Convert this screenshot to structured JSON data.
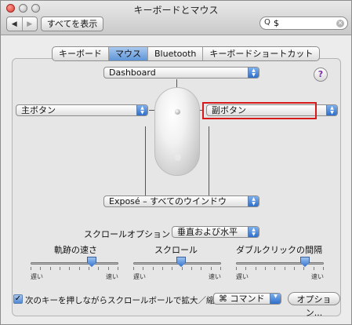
{
  "window": {
    "title": "キーボードとマウス"
  },
  "toolbar": {
    "back_glyph": "◀",
    "forward_glyph": "▶",
    "show_all": "すべてを表示"
  },
  "search": {
    "value": "$",
    "icon": "search-icon"
  },
  "tabs": [
    {
      "label": "キーボード",
      "selected": false
    },
    {
      "label": "マウス",
      "selected": true
    },
    {
      "label": "Bluetooth",
      "selected": false
    },
    {
      "label": "キーボードショートカット",
      "selected": false
    }
  ],
  "mouse_buttons": {
    "top": "Dashboard",
    "left": "主ボタン",
    "right": "副ボタン",
    "bottom": "Exposé – すべてのウインドウ"
  },
  "help": {
    "glyph": "?"
  },
  "scroll": {
    "label": "スクロールオプション",
    "value": "垂直および水平"
  },
  "sliders": [
    {
      "label": "軌跡の速さ",
      "min_label": "遅い",
      "max_label": "速い",
      "value": 0.72
    },
    {
      "label": "スクロール",
      "min_label": "遅い",
      "max_label": "速い",
      "value": 0.55
    },
    {
      "label": "ダブルクリックの間隔",
      "min_label": "遅い",
      "max_label": "速い",
      "value": 0.82
    }
  ],
  "zoom": {
    "checked": true,
    "label": "次のキーを押しながらスクロールボールで拡大／縮小",
    "modifier": "⌘ コマンド"
  },
  "options_button": "オプション...",
  "colors": {
    "accent": "#3a78ce",
    "highlight_box": "#d6191b"
  }
}
